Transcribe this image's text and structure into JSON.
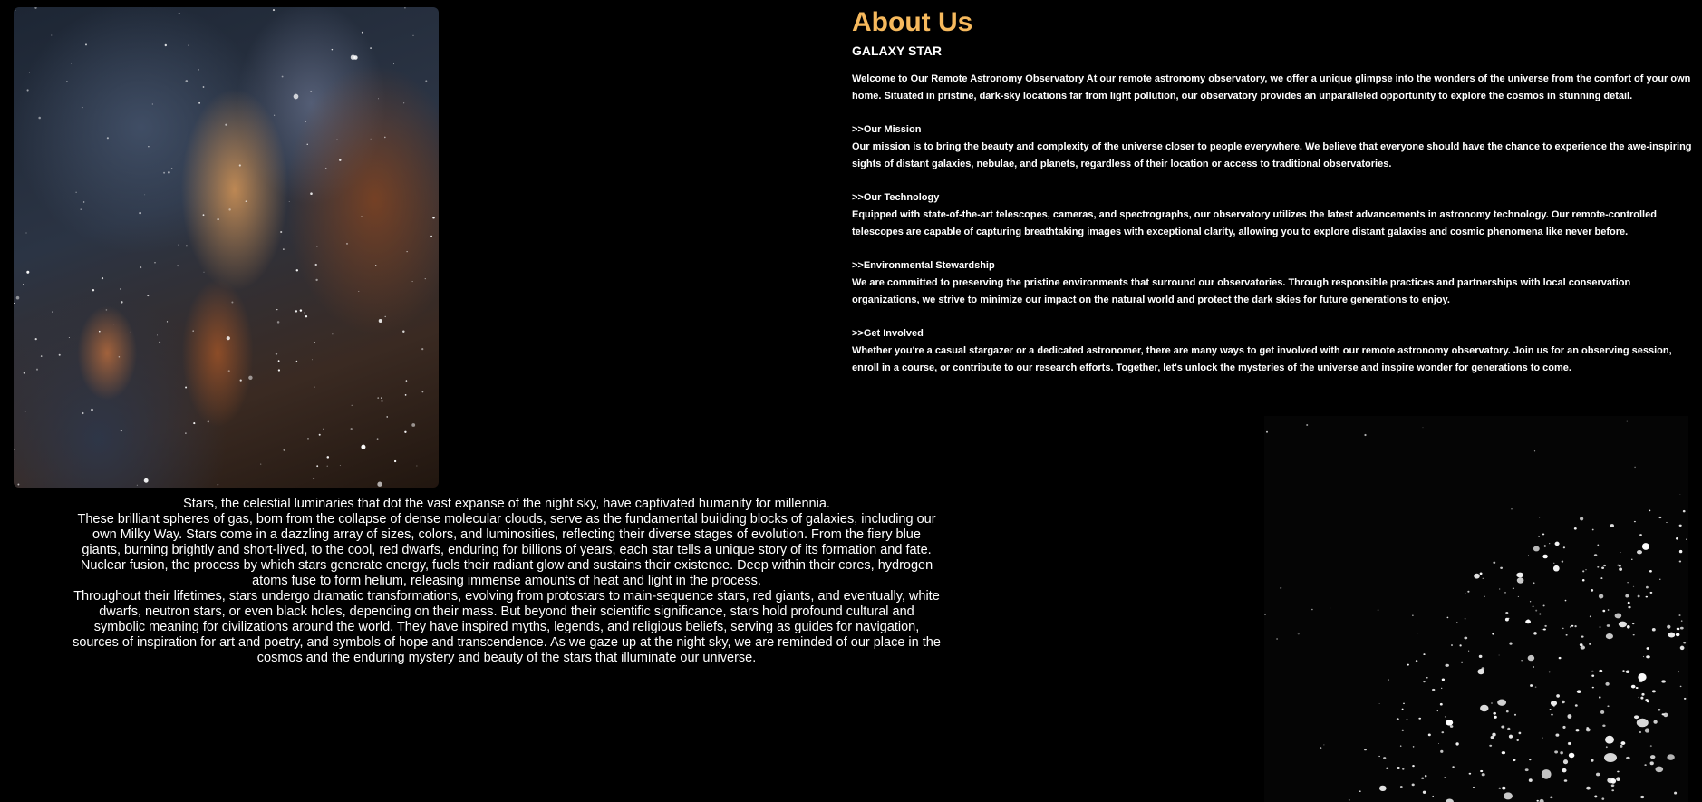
{
  "images": {
    "nebula": "nebula-image",
    "sphere": "star-sphere-image"
  },
  "colors": {
    "background": "#000000",
    "title_accent": "#f6b95d",
    "text": "#ffffff"
  },
  "about": {
    "title": "About Us",
    "subtitle": "GALAXY STAR",
    "intro": "Welcome to Our Remote Astronomy Observatory At our remote astronomy observatory, we offer a unique glimpse into the wonders of the universe from the comfort of your own home. Situated in pristine, dark-sky locations far from light pollution, our observatory provides an unparalleled opportunity to explore the cosmos in stunning detail.",
    "sections": [
      {
        "heading": ">>Our Mission",
        "body": "Our mission is to bring the beauty and complexity of the universe closer to people everywhere. We believe that everyone should have the chance to experience the awe-inspiring sights of distant galaxies, nebulae, and planets, regardless of their location or access to traditional observatories."
      },
      {
        "heading": ">>Our Technology",
        "body": "Equipped with state-of-the-art telescopes, cameras, and spectrographs, our observatory utilizes the latest advancements in astronomy technology. Our remote-controlled telescopes are capable of capturing breathtaking images with exceptional clarity, allowing you to explore distant galaxies and cosmic phenomena like never before."
      },
      {
        "heading": ">>Environmental Stewardship",
        "body": "We are committed to preserving the pristine environments that surround our observatories. Through responsible practices and partnerships with local conservation organizations, we strive to minimize our impact on the natural world and protect the dark skies for future generations to enjoy."
      },
      {
        "heading": ">>Get Involved",
        "body": "Whether you're a casual stargazer or a dedicated astronomer, there are many ways to get involved with our remote astronomy observatory. Join us for an observing session, enroll in a course, or contribute to our research efforts. Together, let's unlock the mysteries of the universe and inspire wonder for generations to come."
      }
    ]
  },
  "stars": {
    "line1": "Stars, the celestial luminaries that dot the vast expanse of the night sky, have captivated humanity for millennia.",
    "paragraph2": "These brilliant spheres of gas, born from the collapse of dense molecular clouds, serve as the fundamental building blocks of galaxies, including our own Milky Way. Stars come in a dazzling array of sizes, colors, and luminosities, reflecting their diverse stages of evolution. From the fiery blue giants, burning brightly and short-lived, to the cool, red dwarfs, enduring for billions of years, each star tells a unique story of its formation and fate. Nuclear fusion, the process by which stars generate energy, fuels their radiant glow and sustains their existence. Deep within their cores, hydrogen atoms fuse to form helium, releasing immense amounts of heat and light in the process.",
    "paragraph3": "Throughout their lifetimes, stars undergo dramatic transformations, evolving from protostars to main-sequence stars, red giants, and eventually, white dwarfs, neutron stars, or even black holes, depending on their mass. But beyond their scientific significance, stars hold profound cultural and symbolic meaning for civilizations around the world. They have inspired myths, legends, and religious beliefs, serving as guides for navigation, sources of inspiration for art and poetry, and symbols of hope and transcendence. As we gaze up at the night sky, we are reminded of our place in the cosmos and the enduring mystery and beauty of the stars that illuminate our universe."
  }
}
